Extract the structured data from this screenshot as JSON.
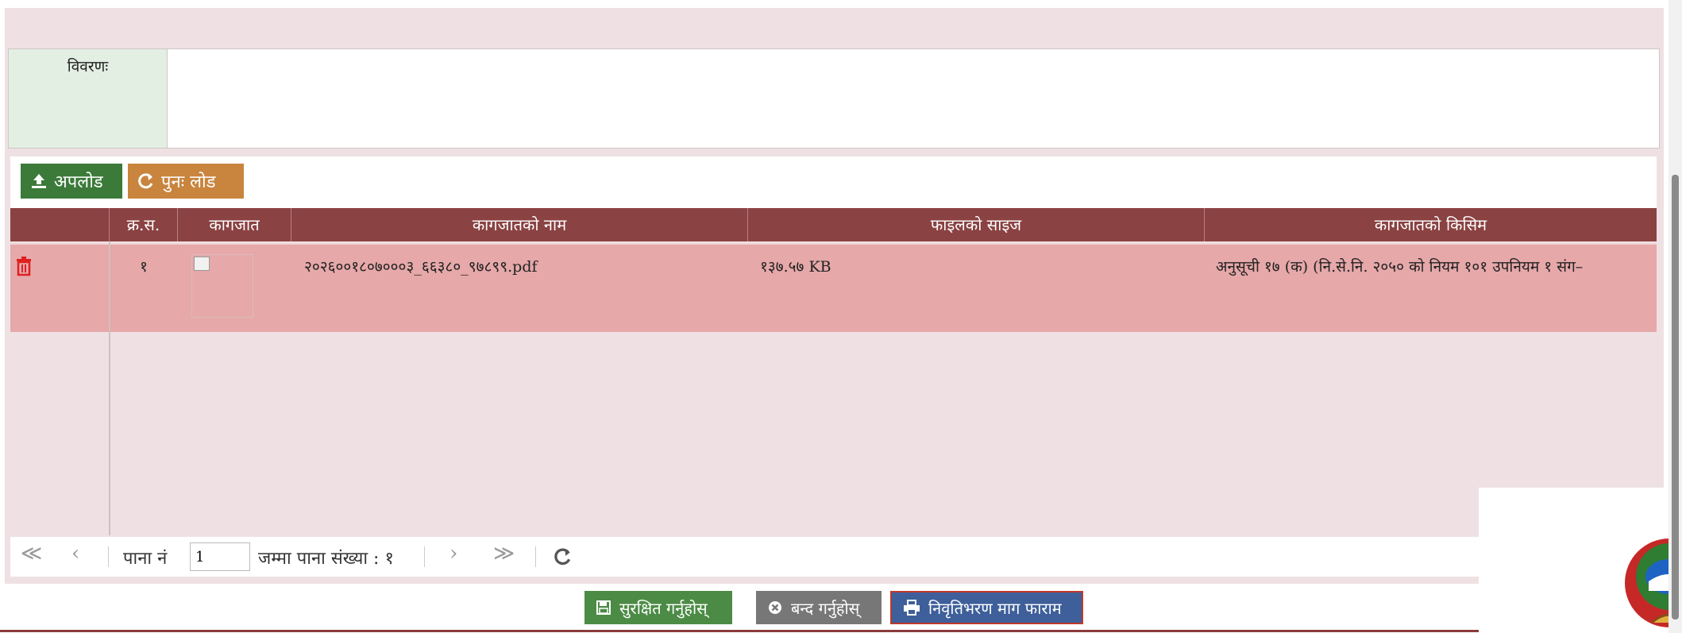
{
  "description": {
    "label": "विवरणः",
    "value": ""
  },
  "toolbar": {
    "upload_label": "अपलोड",
    "reload_label": "पुनः लोड"
  },
  "grid": {
    "columns": [
      "",
      "क्र.स.",
      "कागजात",
      "कागजातको नाम",
      "फाइलको साइज",
      "कागजातको किसिम"
    ],
    "rows": [
      {
        "sn": "१",
        "name": "२०२६००१८०७०००३_६६३८०_९७८९९.pdf",
        "size": "१३७.५७ KB",
        "type": "अनुसूची १७ (क) (नि.से.नि. २०५० को नियम १०१ उपनियम १ संग–"
      }
    ]
  },
  "pager": {
    "first": "≪",
    "prev": "‹",
    "page_label": "पाना नं",
    "page_value": "1",
    "total_label": "जम्मा पाना संख्या : १",
    "next": "›",
    "last": "≫"
  },
  "footer": {
    "save_label": "सुरक्षित गर्नुहोस्",
    "close_label": "बन्द गर्नुहोस्",
    "print_label": "निवृतिभरण माग फाराम"
  },
  "colors": {
    "header": "#8b4242",
    "row": "#e6a8a9",
    "upload": "#3b7a39",
    "reload": "#c9843d",
    "save": "#4c8b45",
    "close": "#777777",
    "print": "#3e5f9a"
  },
  "icons": [
    "upload-icon",
    "refresh-icon",
    "trash-icon",
    "save-icon",
    "close-circle-icon",
    "print-icon",
    "broken-image-icon"
  ]
}
